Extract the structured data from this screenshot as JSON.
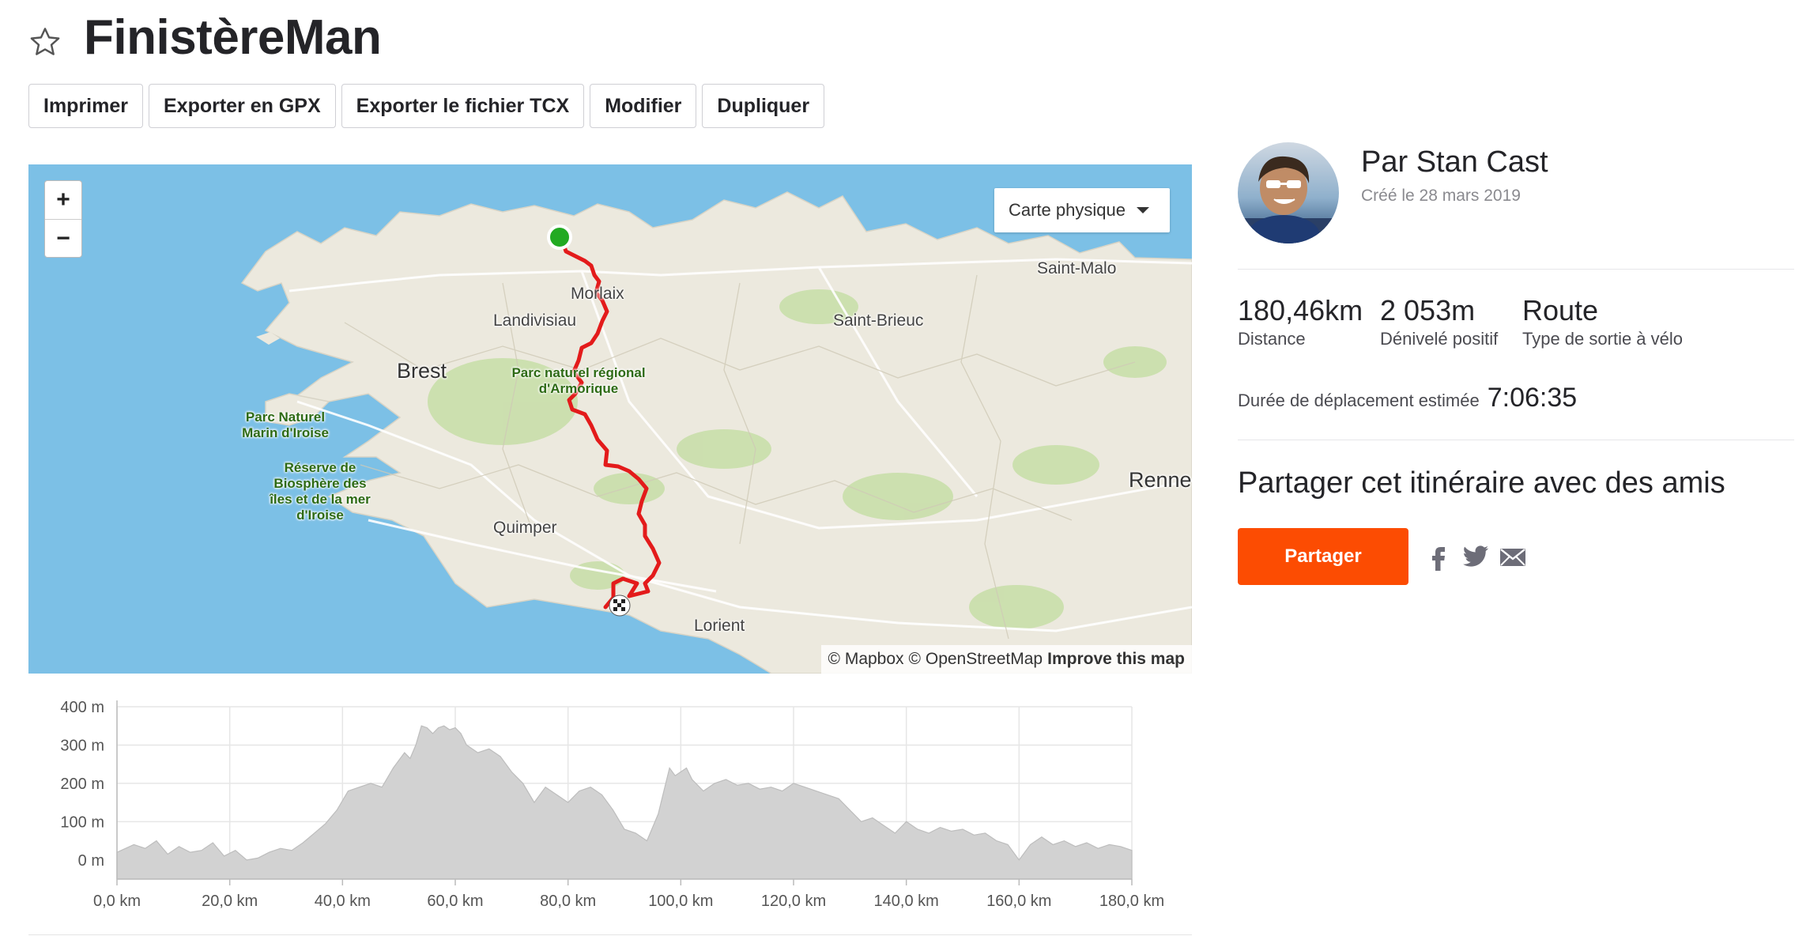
{
  "header": {
    "title": "FinistèreMan",
    "star_icon": "star-outline-icon"
  },
  "toolbar": {
    "print_label": "Imprimer",
    "export_gpx_label": "Exporter en GPX",
    "export_tcx_label": "Exporter le fichier TCX",
    "edit_label": "Modifier",
    "duplicate_label": "Dupliquer"
  },
  "map": {
    "zoom_in_label": "+",
    "zoom_out_label": "−",
    "map_type_label": "Carte physique",
    "places": {
      "saint_malo": "Saint-Malo",
      "morlaix": "Morlaix",
      "landivisiau": "Landivisiau",
      "saint_brieuc": "Saint-Brieuc",
      "brest": "Brest",
      "quimper": "Quimper",
      "lorient": "Lorient",
      "rennes": "Renne",
      "parc_armorique": "Parc naturel régional d'Armorique",
      "parc_iroise": "Parc Naturel Marin d'Iroise",
      "reserve_iroise": "Réserve de Biosphère des îles et de la mer d'Iroise"
    },
    "attribution": {
      "mapbox": "© Mapbox",
      "osm": "© OpenStreetMap",
      "improve": "Improve this map"
    },
    "colors": {
      "sea": "#7cc0e6",
      "land": "#ece9de",
      "forest": "#c9dfaa",
      "route": "#e31b1b",
      "start": "#22aa22"
    }
  },
  "chart_data": {
    "type": "area",
    "title": "",
    "xlabel": "",
    "ylabel": "",
    "x_ticks": [
      "0,0 km",
      "20,0 km",
      "40,0 km",
      "60,0 km",
      "80,0 km",
      "100,0 km",
      "120,0 km",
      "140,0 km",
      "160,0 km",
      "180,0 km"
    ],
    "y_ticks": [
      "0 m",
      "100 m",
      "200 m",
      "300 m",
      "400 m"
    ],
    "xlim": [
      0,
      180
    ],
    "ylim": [
      -50,
      400
    ],
    "grid": true,
    "series": [
      {
        "x": [
          0,
          3,
          5,
          7,
          9,
          11,
          13,
          15,
          17,
          19,
          21,
          23,
          25,
          27,
          29,
          31,
          33,
          35,
          37,
          39,
          41,
          43,
          45,
          47,
          49,
          51,
          52,
          53,
          54,
          55,
          56,
          57,
          58,
          59,
          60,
          61,
          62,
          63,
          64,
          66,
          68,
          70,
          72,
          74,
          76,
          78,
          80,
          82,
          84,
          86,
          88,
          90,
          92,
          94,
          96,
          97,
          98,
          99,
          100,
          101,
          102,
          104,
          106,
          108,
          110,
          112,
          114,
          116,
          118,
          120,
          122,
          124,
          126,
          128,
          130,
          132,
          134,
          136,
          138,
          140,
          142,
          144,
          146,
          148,
          150,
          152,
          154,
          156,
          158,
          160,
          161,
          162,
          164,
          166,
          168,
          170,
          172,
          174,
          176,
          178,
          180
        ],
        "values": [
          20,
          40,
          30,
          50,
          15,
          35,
          20,
          25,
          45,
          10,
          25,
          0,
          5,
          20,
          30,
          25,
          45,
          70,
          95,
          130,
          180,
          190,
          200,
          190,
          240,
          280,
          265,
          300,
          350,
          345,
          330,
          345,
          350,
          340,
          345,
          330,
          300,
          290,
          280,
          290,
          270,
          230,
          200,
          150,
          190,
          170,
          150,
          180,
          190,
          170,
          130,
          80,
          70,
          50,
          120,
          180,
          240,
          220,
          230,
          240,
          210,
          180,
          200,
          210,
          195,
          200,
          185,
          190,
          180,
          200,
          190,
          180,
          170,
          160,
          130,
          100,
          110,
          90,
          70,
          100,
          80,
          70,
          85,
          75,
          80,
          65,
          70,
          50,
          40,
          0,
          20,
          40,
          60,
          40,
          50,
          35,
          45,
          30,
          40,
          35,
          25
        ]
      }
    ]
  },
  "author": {
    "name": "Par Stan Cast",
    "created": "Créé le 28 mars 2019"
  },
  "stats": {
    "distance": {
      "value": "180,46km",
      "label": "Distance"
    },
    "elevation": {
      "value": "2 053m",
      "label": "Dénivelé positif"
    },
    "type": {
      "value": "Route",
      "label": "Type de sortie à vélo"
    },
    "duration": {
      "value": "7:06:35",
      "label": "Durée de déplacement estimée"
    }
  },
  "share": {
    "title": "Partager cet itinéraire avec des amis",
    "button_label": "Partager",
    "accent": "#fc4c02"
  }
}
